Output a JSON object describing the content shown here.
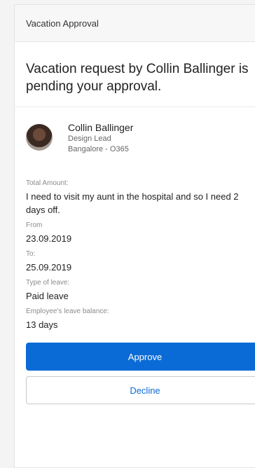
{
  "header": {
    "title": "Vacation Approval"
  },
  "request": {
    "heading": "Vacation request by Collin Ballinger is pending your approval."
  },
  "employee": {
    "name": "Collin Ballinger",
    "role": "Design Lead",
    "location": "Bangalore - O365"
  },
  "fields": [
    {
      "label": "Total Amount:",
      "value": "I need to visit my aunt in the hospital and so I need 2 days off."
    },
    {
      "label": "From",
      "value": "23.09.2019"
    },
    {
      "label": "To:",
      "value": "25.09.2019"
    },
    {
      "label": "Type of leave:",
      "value": "Paid leave"
    },
    {
      "label": "Employee's leave balance:",
      "value": "13 days"
    }
  ],
  "actions": {
    "approve": "Approve",
    "decline": "Decline"
  },
  "colors": {
    "primary": "#0b6bd6"
  }
}
